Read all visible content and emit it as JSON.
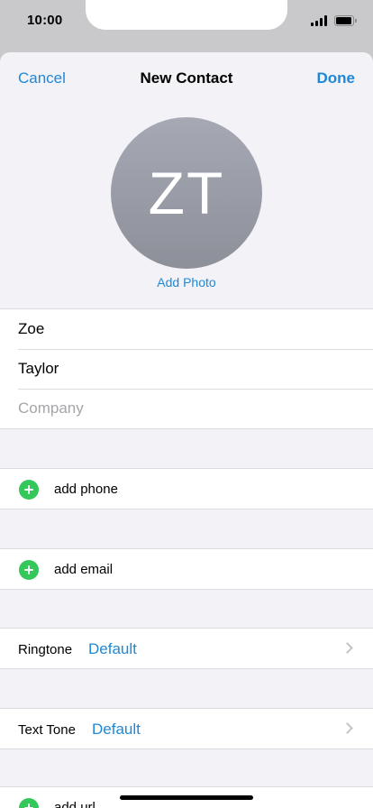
{
  "status_bar": {
    "time": "10:00"
  },
  "nav": {
    "cancel_label": "Cancel",
    "title": "New Contact",
    "done_label": "Done"
  },
  "avatar": {
    "initials": "ZT",
    "add_photo_label": "Add Photo"
  },
  "name_fields": {
    "first_name": "Zoe",
    "last_name": "Taylor",
    "company_placeholder": "Company"
  },
  "add_phone_label": "add phone",
  "add_email_label": "add email",
  "ringtone": {
    "label": "Ringtone",
    "value": "Default"
  },
  "text_tone": {
    "label": "Text Tone",
    "value": "Default"
  },
  "add_url_label": "add url",
  "colors": {
    "accent": "#1e88d8",
    "add_green": "#34c759",
    "sheet_bg": "#f2f2f7",
    "avatar_gray": "#9a9da7"
  }
}
